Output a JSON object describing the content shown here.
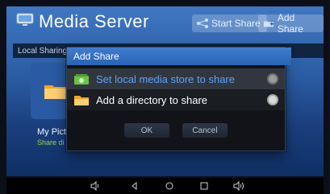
{
  "app": {
    "title": "Media Server",
    "header_buttons": {
      "start_share": "Start Share",
      "add_share": "Add Share"
    },
    "local_strip_label": "Local Sharing",
    "background_item": {
      "title": "My Pict",
      "subtitle": "Share di"
    }
  },
  "dialog": {
    "title": "Add Share",
    "options": [
      {
        "label": "Set local media store to share",
        "selected": true
      },
      {
        "label": "Add a directory to share",
        "selected": false
      }
    ],
    "buttons": {
      "ok": "OK",
      "cancel": "Cancel"
    }
  },
  "navbar": {
    "icons": [
      "volume-down-icon",
      "back-icon",
      "home-icon",
      "recent-apps-icon",
      "volume-up-icon"
    ]
  },
  "colors": {
    "header_gradient_top": "#3f77c2",
    "dialog_header": "#3e7ed1",
    "option_selected_bg": "#32373f",
    "option_selected_text": "#5aa1ff",
    "folder_orange": "#f5a623",
    "folder_green": "#9ad04a",
    "bg_item_subtitle": "#9ad04a"
  }
}
